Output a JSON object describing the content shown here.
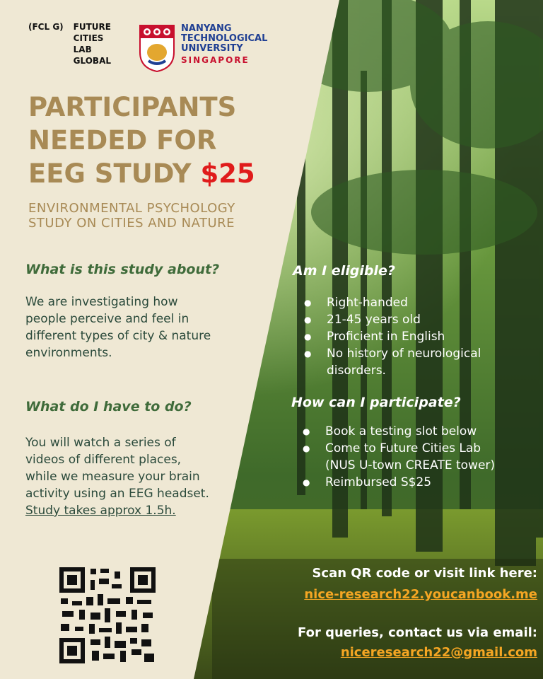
{
  "header": {
    "fcl_abbrev": "(FCL G)",
    "fcl_name": [
      "FUTURE",
      "CITIES",
      "LAB",
      "GLOBAL"
    ],
    "ntu_name": [
      "NANYANG",
      "TECHNOLOGICAL",
      "UNIVERSITY"
    ],
    "ntu_location": "SINGAPORE"
  },
  "title": {
    "line1": "PARTICIPANTS",
    "line2": "NEEDED FOR",
    "line3": "EEG STUDY",
    "price": "$25"
  },
  "subtitle": [
    "ENVIRONMENTAL PSYCHOLOGY",
    "STUDY ON CITIES AND NATURE"
  ],
  "about": {
    "heading": "What is this study about?",
    "lines": [
      "We are investigating how",
      "people perceive and feel in",
      "different types of city & nature",
      "environments."
    ]
  },
  "todo": {
    "heading": "What do I have to do?",
    "lines": [
      "You will watch a series of",
      "videos of different places,",
      "while we measure your brain",
      "activity using an EEG headset."
    ],
    "duration": "Study takes approx 1.5h."
  },
  "eligible": {
    "heading": "Am I eligible?",
    "items": [
      [
        "Right-handed"
      ],
      [
        "21-45 years old"
      ],
      [
        "Proficient in English"
      ],
      [
        "No history of neurological",
        "disorders."
      ]
    ]
  },
  "participate": {
    "heading": "How can I participate?",
    "items": [
      [
        "Book a testing slot below"
      ],
      [
        "Come to Future Cities Lab",
        "(NUS U-town CREATE tower)"
      ],
      [
        "Reimbursed S$25"
      ]
    ]
  },
  "cta": {
    "scan_text": "Scan QR code or visit link here:",
    "booking_link": "nice-research22.youcanbook.me",
    "contact_text": "For queries, contact us via email:",
    "email": "niceresearch22@gmail.com"
  },
  "colors": {
    "cream": "#efe8d4",
    "gold": "#a88a55",
    "green_heading": "#3f6b3a",
    "price_red": "#e01b1b",
    "link_orange": "#f5a623",
    "ntu_blue": "#1f3f93",
    "ntu_red": "#c8102e"
  }
}
